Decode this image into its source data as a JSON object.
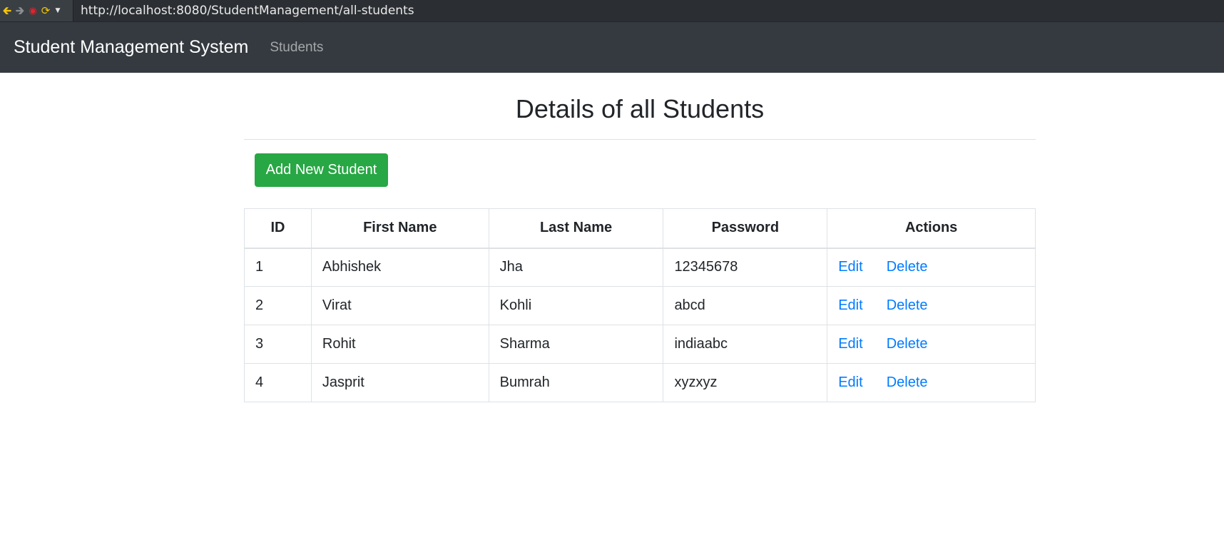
{
  "browser": {
    "url": "http://localhost:8080/StudentManagement/all-students",
    "controls": {
      "back": "🡰",
      "forward": "🡲",
      "stop": "◉",
      "reload": "⟳",
      "menu": "▼"
    }
  },
  "navbar": {
    "brand": "Student Management System",
    "link_students": "Students"
  },
  "main": {
    "title": "Details of all Students",
    "add_button_label": "Add New Student",
    "table": {
      "headers": [
        "ID",
        "First Name",
        "Last Name",
        "Password",
        "Actions"
      ],
      "rows": [
        {
          "id": "1",
          "first_name": "Abhishek",
          "last_name": "Jha",
          "password": "12345678"
        },
        {
          "id": "2",
          "first_name": "Virat",
          "last_name": "Kohli",
          "password": "abcd"
        },
        {
          "id": "3",
          "first_name": "Rohit",
          "last_name": "Sharma",
          "password": "indiaabc"
        },
        {
          "id": "4",
          "first_name": "Jasprit",
          "last_name": "Bumrah",
          "password": "xyzxyz"
        }
      ],
      "edit_label": "Edit",
      "delete_label": "Delete"
    }
  },
  "colors": {
    "navbar_bg": "#343a40",
    "success": "#28a745",
    "link": "#007bff"
  }
}
